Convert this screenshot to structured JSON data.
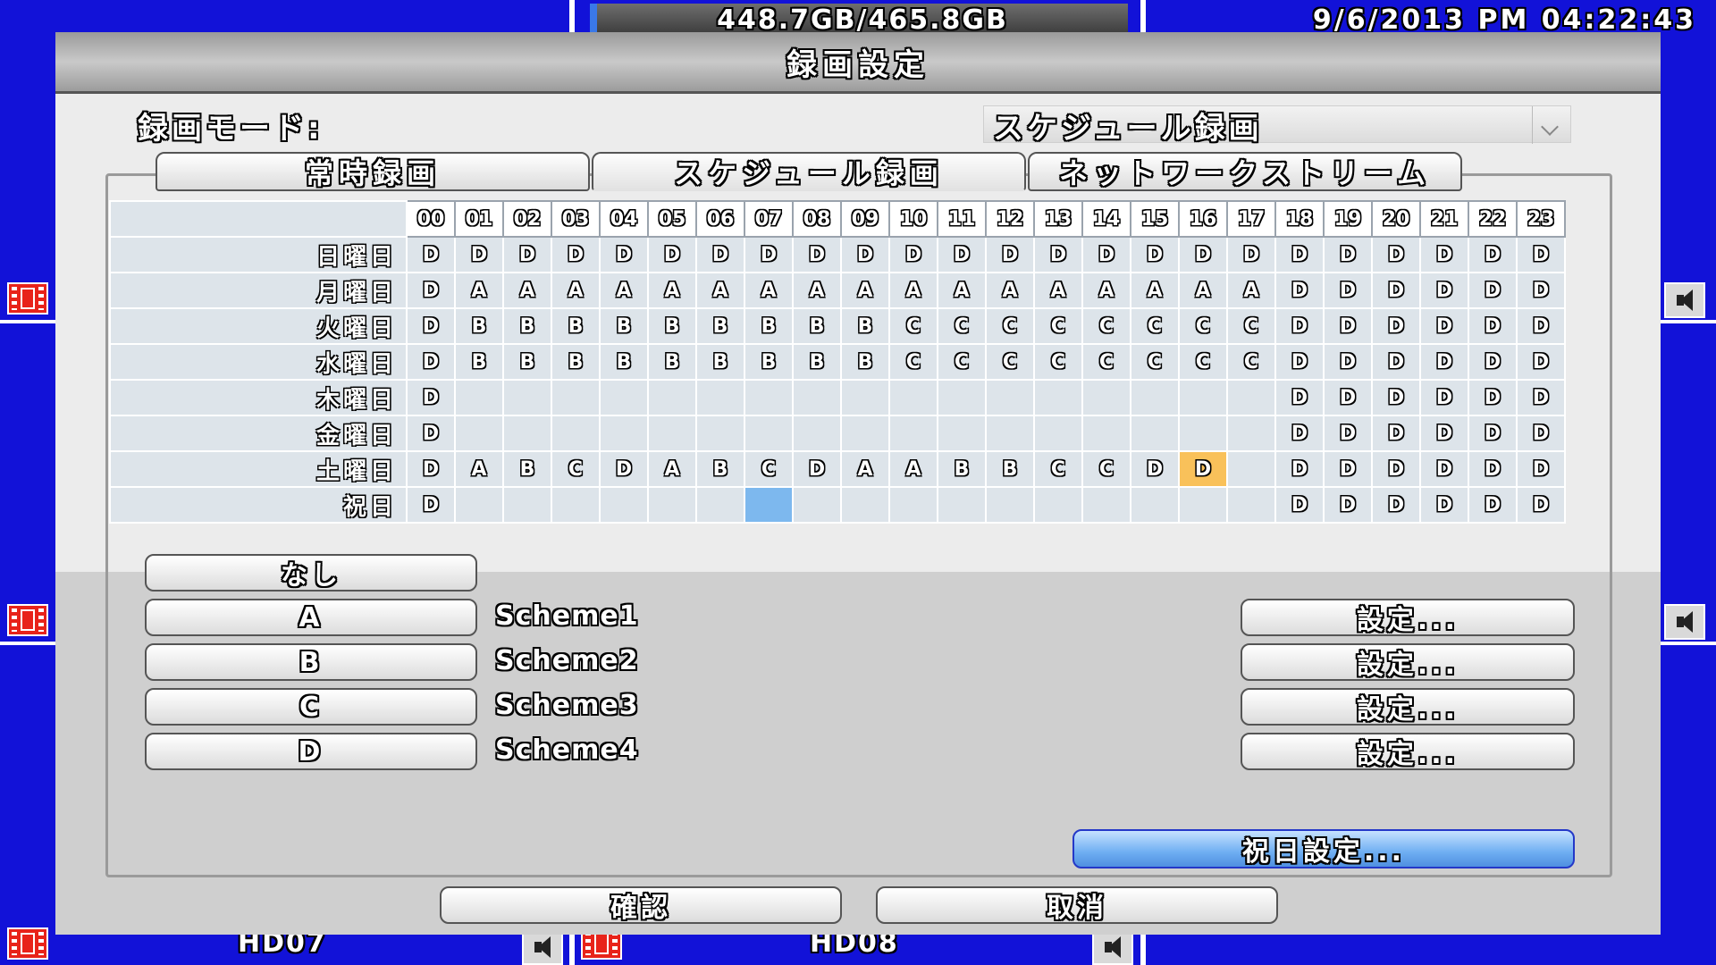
{
  "status": {
    "disk_usage": "448.7GB/465.8GB",
    "datetime": "9/6/2013 PM 04:22:43"
  },
  "channels": {
    "bottom_left_label": "HD07",
    "bottom_right_label": "HD08"
  },
  "dialog": {
    "title": "録画設定",
    "mode_label": "録画モード:",
    "mode_value": "スケジュール録画",
    "tabs": [
      {
        "label": "常時録画",
        "active": false
      },
      {
        "label": "スケジュール録画",
        "active": true
      },
      {
        "label": "ネットワークストリーム",
        "active": false
      }
    ],
    "hours": [
      "00",
      "01",
      "02",
      "03",
      "04",
      "05",
      "06",
      "07",
      "08",
      "09",
      "10",
      "11",
      "12",
      "13",
      "14",
      "15",
      "16",
      "17",
      "18",
      "19",
      "20",
      "21",
      "22",
      "23"
    ],
    "days": [
      {
        "label": "日曜日",
        "cells": [
          "D",
          "D",
          "D",
          "D",
          "D",
          "D",
          "D",
          "D",
          "D",
          "D",
          "D",
          "D",
          "D",
          "D",
          "D",
          "D",
          "D",
          "D",
          "D",
          "D",
          "D",
          "D",
          "D",
          "D"
        ]
      },
      {
        "label": "月曜日",
        "cells": [
          "D",
          "A",
          "A",
          "A",
          "A",
          "A",
          "A",
          "A",
          "A",
          "A",
          "A",
          "A",
          "A",
          "A",
          "A",
          "A",
          "A",
          "A",
          "D",
          "D",
          "D",
          "D",
          "D",
          "D"
        ]
      },
      {
        "label": "火曜日",
        "cells": [
          "D",
          "B",
          "B",
          "B",
          "B",
          "B",
          "B",
          "B",
          "B",
          "B",
          "C",
          "C",
          "C",
          "C",
          "C",
          "C",
          "C",
          "C",
          "D",
          "D",
          "D",
          "D",
          "D",
          "D"
        ]
      },
      {
        "label": "水曜日",
        "cells": [
          "D",
          "B",
          "B",
          "B",
          "B",
          "B",
          "B",
          "B",
          "B",
          "B",
          "C",
          "C",
          "C",
          "C",
          "C",
          "C",
          "C",
          "C",
          "D",
          "D",
          "D",
          "D",
          "D",
          "D"
        ]
      },
      {
        "label": "木曜日",
        "cells": [
          "D",
          "",
          "",
          "",
          "",
          "",
          "",
          "",
          "",
          "",
          "",
          "",
          "",
          "",
          "",
          "",
          "",
          "",
          "D",
          "D",
          "D",
          "D",
          "D",
          "D"
        ]
      },
      {
        "label": "金曜日",
        "cells": [
          "D",
          "",
          "",
          "",
          "",
          "",
          "",
          "",
          "",
          "",
          "",
          "",
          "",
          "",
          "",
          "",
          "",
          "",
          "D",
          "D",
          "D",
          "D",
          "D",
          "D"
        ]
      },
      {
        "label": "土曜日",
        "cells": [
          "D",
          "A",
          "B",
          "C",
          "D",
          "A",
          "B",
          "C",
          "D",
          "A",
          "A",
          "B",
          "B",
          "C",
          "C",
          "D",
          "D",
          "",
          "D",
          "D",
          "D",
          "D",
          "D",
          "D"
        ]
      },
      {
        "label": "祝日",
        "cells": [
          "D",
          "",
          "",
          "",
          "",
          "",
          "",
          "",
          "",
          "",
          "",
          "",
          "",
          "",
          "",
          "",
          "",
          "",
          "D",
          "D",
          "D",
          "D",
          "D",
          "D"
        ]
      }
    ],
    "none_button": "なし",
    "schemes": [
      {
        "button": "A",
        "name": "Scheme1",
        "setting": "設定..."
      },
      {
        "button": "B",
        "name": "Scheme2",
        "setting": "設定..."
      },
      {
        "button": "C",
        "name": "Scheme3",
        "setting": "設定..."
      },
      {
        "button": "D",
        "name": "Scheme4",
        "setting": "設定..."
      }
    ],
    "holiday_button": "祝日設定...",
    "ok_button": "確認",
    "cancel_button": "取消"
  },
  "colors": {
    "background": "#1212d8",
    "selected_cell": "#f9c15a",
    "cursor_cell": "#7db8ee",
    "holiday_button": "#6eaef2"
  }
}
